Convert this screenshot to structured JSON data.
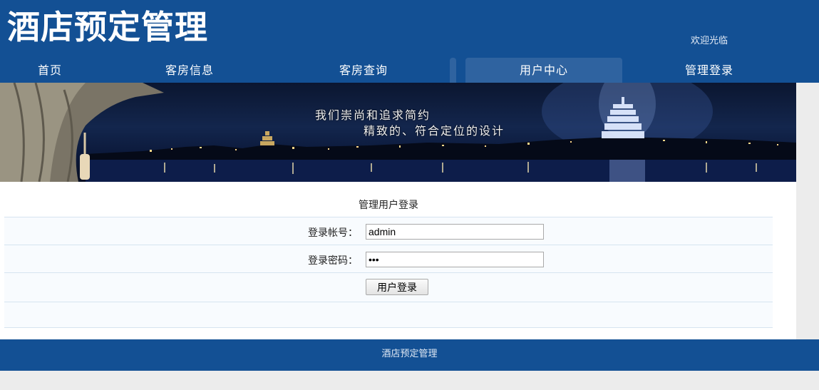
{
  "header": {
    "site_title": "酒店预定管理",
    "welcome": "欢迎光临"
  },
  "nav": {
    "items": [
      {
        "label": "首页"
      },
      {
        "label": "客房信息"
      },
      {
        "label": "客房查询"
      },
      {
        "label": "用户中心",
        "active": true
      },
      {
        "label": "管理登录"
      }
    ]
  },
  "banner": {
    "slogan_line1": "我们崇尚和追求简约",
    "slogan_line2": "精致的、符合定位的设计"
  },
  "login_form": {
    "title": "管理用户登录",
    "username_label": "登录帐号：",
    "username_value": "admin",
    "password_label": "登录密码：",
    "password_value": "•••",
    "submit_label": "用户登录"
  },
  "footer": {
    "text": "酒店预定管理"
  },
  "colors": {
    "brand_blue": "#135094",
    "nav_active": "#2f63a0",
    "page_bg": "#ececec"
  }
}
